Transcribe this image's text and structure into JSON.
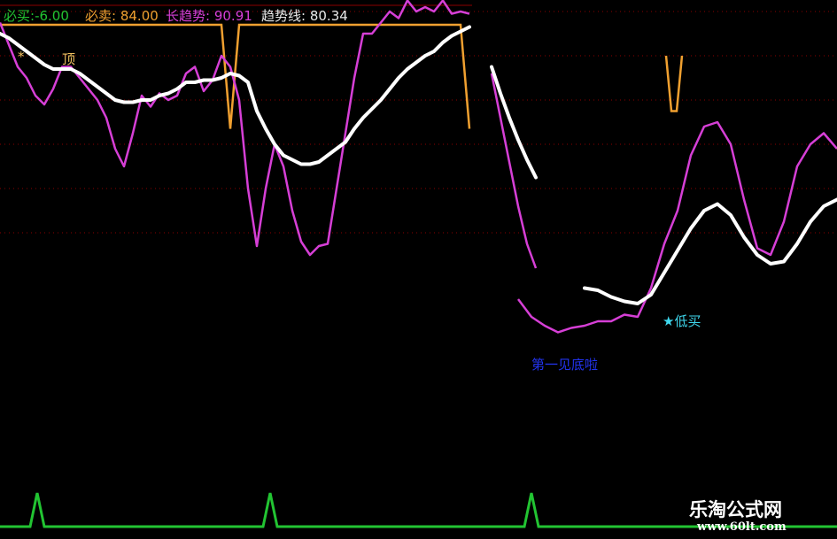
{
  "header": {
    "buy": {
      "label": "必买:",
      "value": "-6.00",
      "color": "#22c432"
    },
    "sell": {
      "label": "必卖:",
      "value": "84.00",
      "color": "#f0a030"
    },
    "long": {
      "label": "长趋势:",
      "value": "90.91",
      "color": "#d63fd6"
    },
    "trend": {
      "label": "趋势线:",
      "value": "80.34",
      "color": "#e8e8e8"
    }
  },
  "annotations": {
    "top_star": "*",
    "top_label": "顶",
    "low_buy": "★低买",
    "dragon": "第一见底啦"
  },
  "watermark": {
    "name": "乐淘公式网",
    "url": "www.60lt.com"
  },
  "chart_data": {
    "type": "line",
    "ylim": [
      -10,
      110
    ],
    "grid": true,
    "grid_lines": [
      100,
      80,
      60,
      40,
      20,
      0
    ],
    "colors": {
      "long": "#d63fd6",
      "trend": "#ffffff",
      "sell": "#f0a030",
      "buy": "#22c432",
      "grid": "#8b0000"
    },
    "segments": [
      {
        "x": [
          0,
          10,
          20,
          30,
          40,
          50,
          60,
          70,
          80,
          90,
          100,
          110,
          120,
          130,
          140,
          150,
          160,
          170,
          180,
          190,
          200,
          210,
          220,
          230,
          240,
          250,
          260,
          270,
          280,
          290,
          300,
          310,
          320,
          330,
          340,
          350,
          360,
          370,
          380,
          390,
          400,
          410,
          420,
          430,
          440,
          450,
          460,
          470,
          480,
          490,
          500,
          510,
          520,
          530
        ],
        "long": [
          95,
          85,
          75,
          70,
          62,
          58,
          65,
          75,
          75,
          70,
          65,
          60,
          52,
          38,
          30,
          45,
          62,
          57,
          63,
          60,
          62,
          72,
          75,
          64,
          69,
          80,
          75,
          60,
          20,
          -6,
          20,
          40,
          30,
          10,
          -4,
          -10,
          -6,
          -5,
          20,
          45,
          70,
          90,
          90,
          95,
          100,
          97,
          105,
          100,
          102,
          100,
          105,
          99,
          100,
          99
        ],
        "trend": [
          90,
          88,
          85,
          82,
          79,
          76,
          74,
          74,
          74,
          72,
          69,
          66,
          63,
          60,
          59,
          59,
          60,
          60,
          62,
          63,
          65,
          68,
          68,
          69,
          69,
          70,
          72,
          71,
          68,
          55,
          47,
          40,
          35,
          33,
          31,
          31,
          32,
          35,
          38,
          41,
          47,
          52,
          56,
          60,
          65,
          70,
          74,
          77,
          80,
          82,
          86,
          89,
          91,
          93
        ],
        "sell": [
          94,
          94,
          94,
          94,
          94,
          94,
          94,
          94,
          94,
          94,
          94,
          94,
          94,
          94,
          94,
          94,
          94,
          94,
          94,
          94,
          94,
          94,
          94,
          94,
          94,
          94,
          47,
          94,
          94,
          94,
          94,
          94,
          94,
          94,
          94,
          94,
          94,
          94,
          94,
          94,
          94,
          94,
          94,
          94,
          94,
          94,
          94,
          94,
          94,
          94,
          94,
          94,
          94,
          47
        ]
      },
      {
        "x": [
          555,
          565,
          575,
          585,
          595,
          605
        ],
        "long": [
          72,
          52,
          32,
          12,
          -5,
          -16
        ],
        "trend": [
          75,
          63,
          52,
          42,
          33,
          25
        ]
      },
      {
        "x": [
          585,
          600,
          615,
          630,
          645,
          660,
          675,
          690,
          705,
          720,
          735,
          750,
          765,
          780,
          795,
          810,
          825,
          840,
          855,
          870,
          885,
          900,
          915,
          930,
          945
        ],
        "long": [
          -30,
          -38,
          -42,
          -45,
          -43,
          -42,
          -40,
          -40,
          -37,
          -38,
          -25,
          -5,
          10,
          35,
          48,
          50,
          40,
          15,
          -7,
          -10,
          5,
          30,
          40,
          45,
          38
        ],
        "trend": [
          null,
          null,
          null,
          null,
          null,
          -25,
          -26,
          -29,
          -31,
          -32,
          -28,
          -18,
          -8,
          2,
          10,
          13,
          8,
          -2,
          -10,
          -14,
          -13,
          -5,
          5,
          12,
          15
        ]
      },
      {
        "x": [
          752,
          758,
          764,
          770
        ],
        "sell": [
          80,
          55,
          55,
          80
        ]
      }
    ],
    "buy_signal": {
      "baseline": -10,
      "peak": 0,
      "peaks_x": [
        42,
        305,
        600
      ]
    }
  }
}
